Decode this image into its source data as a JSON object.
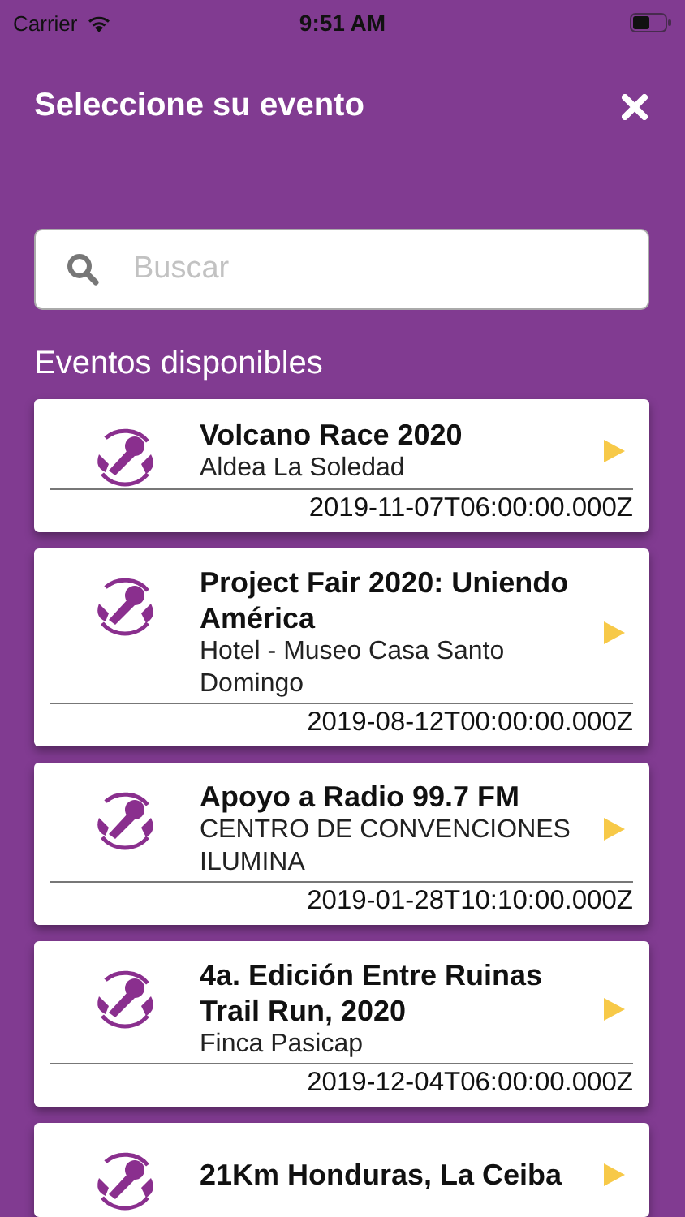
{
  "status_bar": {
    "carrier": "Carrier",
    "time": "9:51 AM"
  },
  "header": {
    "title": "Seleccione su evento"
  },
  "search": {
    "placeholder": "Buscar"
  },
  "section_title": "Eventos disponibles",
  "events": [
    {
      "title": "Volcano Race 2020",
      "place": "Aldea La Soledad",
      "date": "2019-11-07T06:00:00.000Z"
    },
    {
      "title": "Project Fair 2020: Uniendo América",
      "place": "Hotel - Museo Casa Santo Domingo",
      "date": "2019-08-12T00:00:00.000Z"
    },
    {
      "title": "Apoyo a Radio 99.7 FM",
      "place": "CENTRO DE CONVENCIONES ILUMINA",
      "date": "2019-01-28T10:10:00.000Z"
    },
    {
      "title": "4a. Edición Entre Ruinas Trail Run, 2020",
      "place": "Finca Pasicap",
      "date": "2019-12-04T06:00:00.000Z"
    },
    {
      "title": "21Km Honduras, La Ceiba"
    }
  ]
}
